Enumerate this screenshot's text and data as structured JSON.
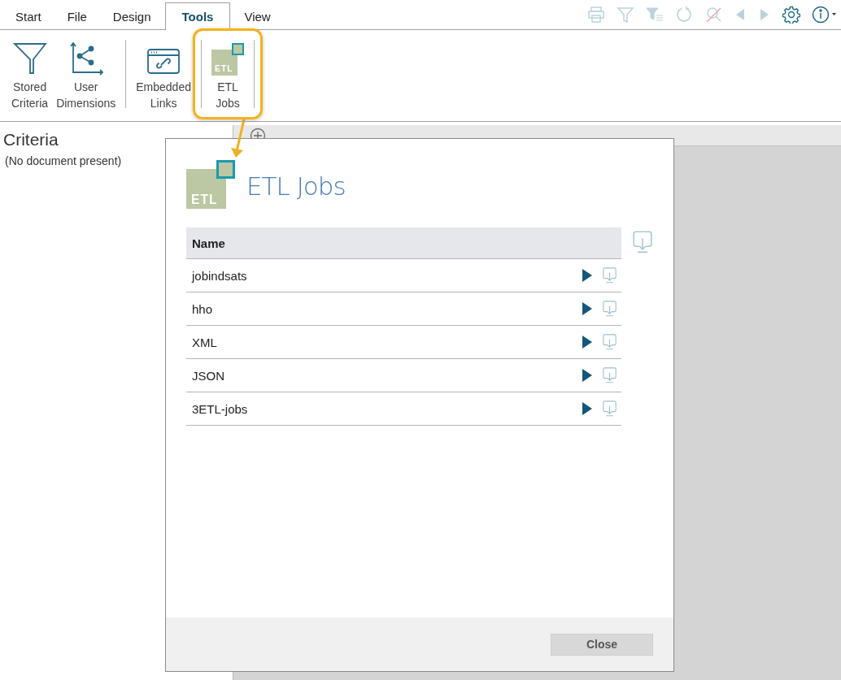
{
  "tabs": [
    {
      "label": "Start",
      "selected": false
    },
    {
      "label": "File",
      "selected": false
    },
    {
      "label": "Design",
      "selected": false
    },
    {
      "label": "Tools",
      "selected": true
    },
    {
      "label": "View",
      "selected": false
    }
  ],
  "quick_toolbar": [
    {
      "kind": "print",
      "disabled": true
    },
    {
      "kind": "filter",
      "disabled": true
    },
    {
      "kind": "filter-list",
      "disabled": true
    },
    {
      "kind": "refresh",
      "disabled": true
    },
    {
      "kind": "clear-search",
      "disabled": true
    },
    {
      "kind": "previous",
      "disabled": true
    },
    {
      "kind": "next",
      "disabled": true
    },
    {
      "kind": "settings",
      "disabled": false
    },
    {
      "kind": "info",
      "disabled": false
    }
  ],
  "ribbon_groups": [
    [
      {
        "kind": "funnel",
        "label": "Stored Criteria",
        "highlighted": false
      },
      {
        "kind": "axes",
        "label": "User Dimensions",
        "highlighted": false
      }
    ],
    [
      {
        "kind": "link-window",
        "label": "Embedded Links",
        "highlighted": false
      }
    ],
    [
      {
        "kind": "etl",
        "badge": "ETL",
        "label": "ETL Jobs",
        "highlighted": true
      }
    ]
  ],
  "criteria_panel": {
    "title": "Criteria",
    "message": "(No document present)"
  },
  "dialog": {
    "logo_text": "ETL",
    "title": "ETL Jobs",
    "columns": [
      "Name"
    ],
    "rows": [
      {
        "name": "jobindsats"
      },
      {
        "name": "hho"
      },
      {
        "name": "XML"
      },
      {
        "name": "JSON"
      },
      {
        "name": "3ETL-jobs"
      }
    ],
    "close_button": "Close"
  }
}
